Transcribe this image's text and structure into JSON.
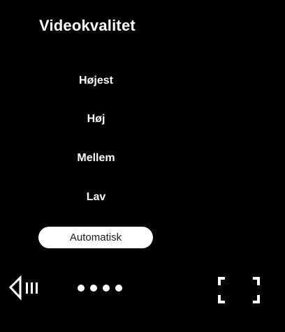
{
  "quality_menu": {
    "title": "Videokvalitet",
    "options": [
      {
        "label": "Højest"
      },
      {
        "label": "Høj"
      },
      {
        "label": "Mellem"
      },
      {
        "label": "Lav"
      }
    ],
    "selected_option": "Automatisk"
  },
  "player_controls": {
    "volume_icon": "volume-icon",
    "more_icon": "more-dots-icon",
    "fullscreen_icon": "fullscreen-icon"
  },
  "colors": {
    "background": "#000000",
    "foreground": "#ffffff",
    "selected_pill_bg": "#ffffff",
    "selected_pill_text": "#1a1a1a"
  }
}
